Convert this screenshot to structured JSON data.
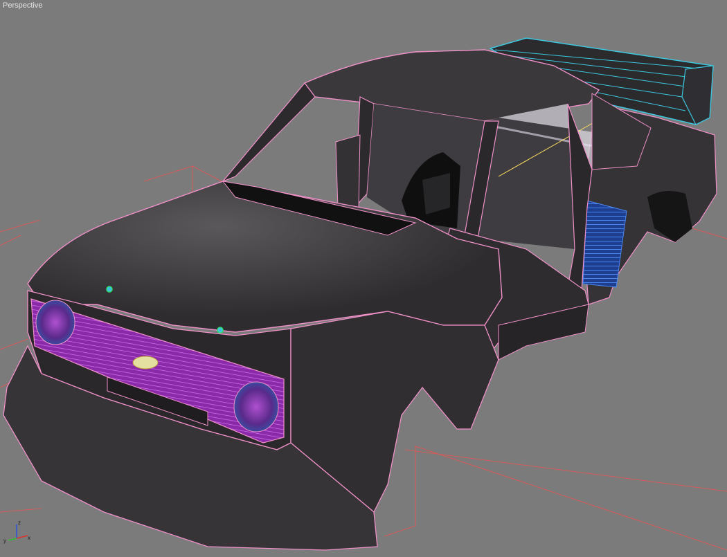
{
  "viewport": {
    "label": "Perspective",
    "background": "#7b7b7b"
  },
  "scene": {
    "object": "car-body-wireframe",
    "body_color": "#3c3a3c",
    "wire_color": "#f090c8",
    "grille_color": "#9a2fb0",
    "spoiler_wire_color": "#3cc8e0",
    "vent_color": "#2a58c8",
    "grid_line_color": "#d85050"
  },
  "axis_gizmo": {
    "x_label": "x",
    "y_label": "y",
    "z_label": "z",
    "x_color": "#e03030",
    "y_color": "#30c030",
    "z_color": "#3050e0"
  }
}
